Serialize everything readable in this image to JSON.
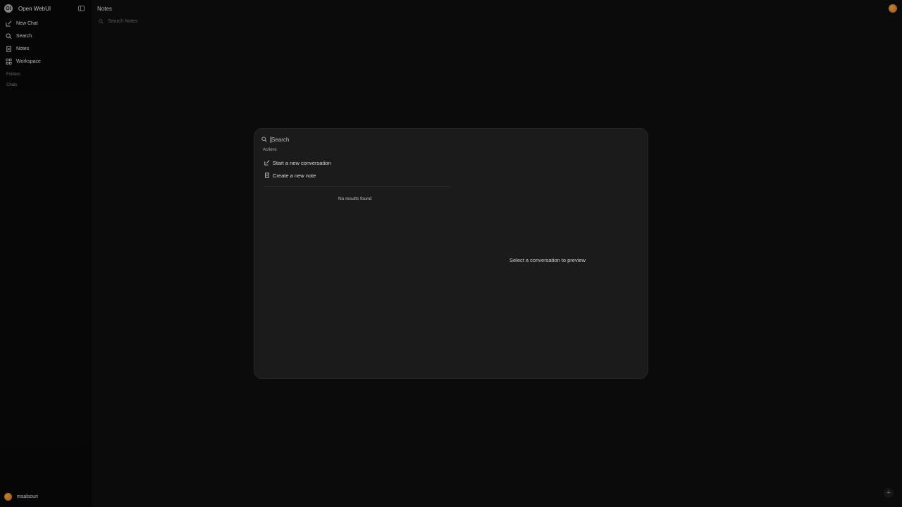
{
  "sidebar": {
    "brand": {
      "logo_text": "OI",
      "name": "Open WebUI"
    },
    "nav": [
      {
        "label": "New Chat",
        "icon": "pencil-square-icon"
      },
      {
        "label": "Search",
        "icon": "search-icon"
      },
      {
        "label": "Notes",
        "icon": "notes-icon"
      },
      {
        "label": "Workspace",
        "icon": "grid-icon"
      }
    ],
    "sections": {
      "folders": "Folders",
      "chats": "Chats"
    },
    "user": {
      "name": "msalsouri"
    }
  },
  "main": {
    "title": "Notes",
    "search_placeholder": "Search Notes",
    "fab_label": "+"
  },
  "modal": {
    "search_placeholder": "Search",
    "search_value": "",
    "actions_label": "Actions",
    "actions": [
      {
        "label": "Start a new conversation",
        "icon": "pencil-square-icon"
      },
      {
        "label": "Create a new note",
        "icon": "note-icon"
      }
    ],
    "no_results": "No results found",
    "preview_hint": "Select a conversation to preview"
  },
  "colors": {
    "background": "#0b0b0b",
    "modal": "#1b1b1b",
    "avatar_accent": "#d9822b"
  }
}
